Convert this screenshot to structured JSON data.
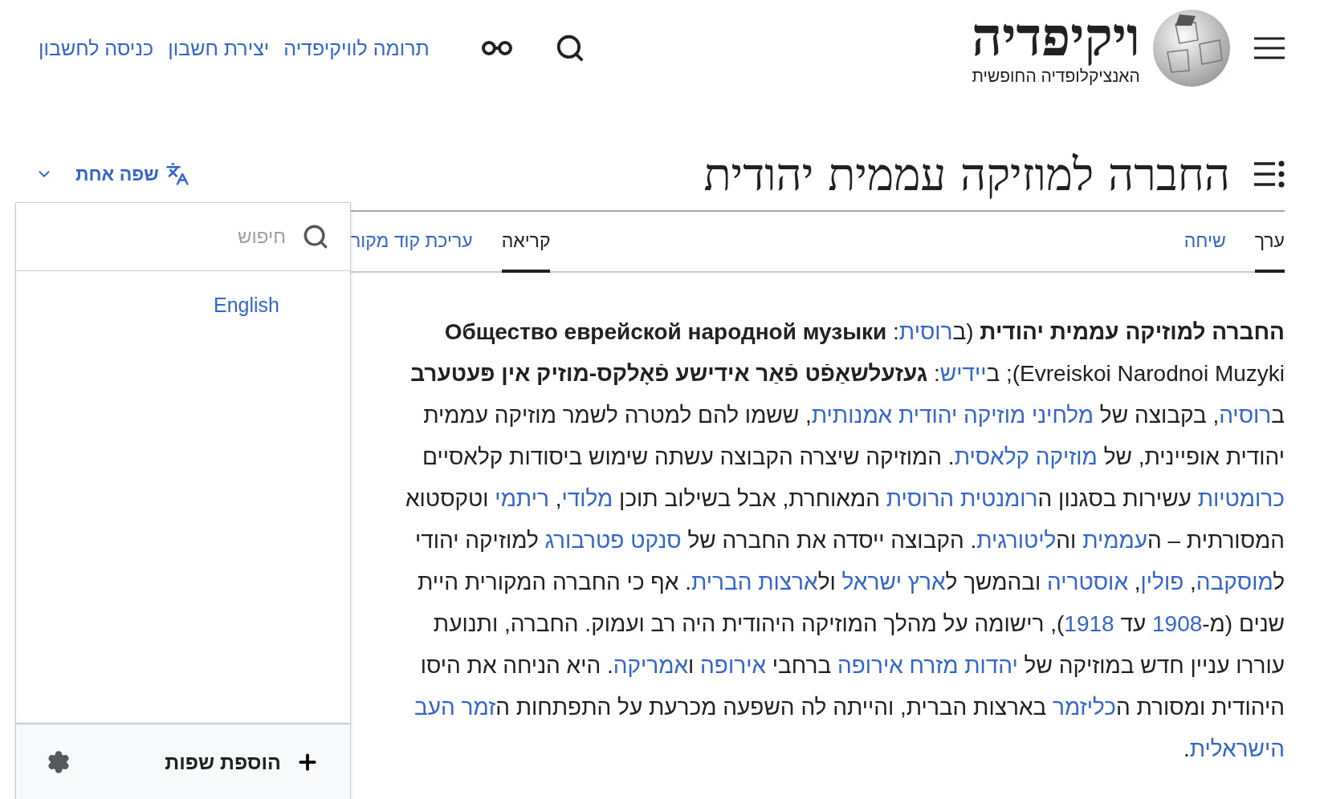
{
  "header": {
    "wordmark": "ויקיפדיה",
    "tagline": "האנציקלופדיה החופשית",
    "links": [
      "תרומה לוויקיפדיה",
      "יצירת חשבון",
      "כניסה לחשבון"
    ]
  },
  "page": {
    "title": "החברה למוזיקה עממית יהודית",
    "language_button": "שפה אחת"
  },
  "tabs_right": [
    {
      "label": "ערך",
      "selected": true
    },
    {
      "label": "שיחה",
      "selected": false
    }
  ],
  "tabs_left": [
    {
      "label": "קריאה",
      "selected": true
    },
    {
      "label": "עריכת קוד מקור",
      "selected": false
    }
  ],
  "article": {
    "lines": [
      [
        {
          "kind": "bold",
          "text": "החברה למוזיקה עממית יהודית"
        },
        {
          "kind": "text",
          "text": " (ב"
        },
        {
          "kind": "link",
          "text": "רוסית"
        },
        {
          "kind": "text",
          "text": ": "
        },
        {
          "kind": "bold",
          "text": "Общество еврейской народной музыки"
        }
      ],
      [
        {
          "kind": "text",
          "text": "Evreiskoi Narodnoi Muzyki); ב"
        },
        {
          "kind": "link",
          "text": "יידיש"
        },
        {
          "kind": "text",
          "text": ": "
        },
        {
          "kind": "bold",
          "text": "געזעלשאַפֿט פֿאַר אידישע פֿאָלקס-מוזיק אין פּעטערב"
        }
      ],
      [
        {
          "kind": "text",
          "text": "ב"
        },
        {
          "kind": "link",
          "text": "רוסיה"
        },
        {
          "kind": "text",
          "text": ", בקבוצה של "
        },
        {
          "kind": "link",
          "text": "מלחיני מוזיקה יהודית אמנותית"
        },
        {
          "kind": "text",
          "text": ", ששמו להם למטרה לשמר מוזיקה עממית"
        }
      ],
      [
        {
          "kind": "text",
          "text": "יהודית אופיינית, של "
        },
        {
          "kind": "link",
          "text": "מוזיקה קלאסית"
        },
        {
          "kind": "text",
          "text": ". המוזיקה שיצרה הקבוצה עשתה שימוש ביסודות קלאסיים"
        }
      ],
      [
        {
          "kind": "link",
          "text": "כרומטיות"
        },
        {
          "kind": "text",
          "text": " עשירות בסגנון ה"
        },
        {
          "kind": "link",
          "text": "רומנטית הרוסית"
        },
        {
          "kind": "text",
          "text": " המאוחרת, אבל בשילוב תוכן "
        },
        {
          "kind": "link",
          "text": "מלודי"
        },
        {
          "kind": "text",
          "text": ", "
        },
        {
          "kind": "link",
          "text": "ריתמי"
        },
        {
          "kind": "text",
          "text": " וטקסטוא"
        }
      ],
      [
        {
          "kind": "text",
          "text": "המסורתית – ה"
        },
        {
          "kind": "link",
          "text": "עממית"
        },
        {
          "kind": "text",
          "text": " וה"
        },
        {
          "kind": "link",
          "text": "ליטורגית"
        },
        {
          "kind": "text",
          "text": ". הקבוצה ייסדה את החברה של "
        },
        {
          "kind": "link",
          "text": "סנקט פטרבורג"
        },
        {
          "kind": "text",
          "text": " למוזיקה יהודי"
        }
      ],
      [
        {
          "kind": "text",
          "text": "ל"
        },
        {
          "kind": "link",
          "text": "מוסקבה"
        },
        {
          "kind": "text",
          "text": ", "
        },
        {
          "kind": "link",
          "text": "פולין"
        },
        {
          "kind": "text",
          "text": ", "
        },
        {
          "kind": "link",
          "text": "אוסטריה"
        },
        {
          "kind": "text",
          "text": " ובהמשך ל"
        },
        {
          "kind": "link",
          "text": "ארץ ישראל"
        },
        {
          "kind": "text",
          "text": " ול"
        },
        {
          "kind": "link",
          "text": "ארצות הברית"
        },
        {
          "kind": "text",
          "text": ". אף כי החברה המקורית היית"
        }
      ],
      [
        {
          "kind": "text",
          "text": "שנים (מ-"
        },
        {
          "kind": "link",
          "text": "1908"
        },
        {
          "kind": "text",
          "text": " עד "
        },
        {
          "kind": "link",
          "text": "1918"
        },
        {
          "kind": "text",
          "text": "), רישומה על מהלך המוזיקה היהודית היה רב ועמוק. החברה, ותנועת"
        }
      ],
      [
        {
          "kind": "text",
          "text": "עוררו עניין חדש במוזיקה של "
        },
        {
          "kind": "link",
          "text": "יהדות מזרח אירופה"
        },
        {
          "kind": "text",
          "text": " ברחבי "
        },
        {
          "kind": "link",
          "text": "אירופה"
        },
        {
          "kind": "text",
          "text": " ו"
        },
        {
          "kind": "link",
          "text": "אמריקה"
        },
        {
          "kind": "text",
          "text": ". היא הניחה את היסו"
        }
      ],
      [
        {
          "kind": "text",
          "text": "היהודית ומסורת ה"
        },
        {
          "kind": "link",
          "text": "כליזמר"
        },
        {
          "kind": "text",
          "text": " בארצות הברית, והייתה לה השפעה מכרעת על התפתחות ה"
        },
        {
          "kind": "link",
          "text": "זמר העב"
        }
      ],
      [
        {
          "kind": "link",
          "text": "הישראלית"
        },
        {
          "kind": "text",
          "text": "."
        }
      ]
    ]
  },
  "language_menu": {
    "search": {
      "placeholder": "חיפוש"
    },
    "languages": [
      "English"
    ],
    "add_button": "הוספת שפות"
  }
}
